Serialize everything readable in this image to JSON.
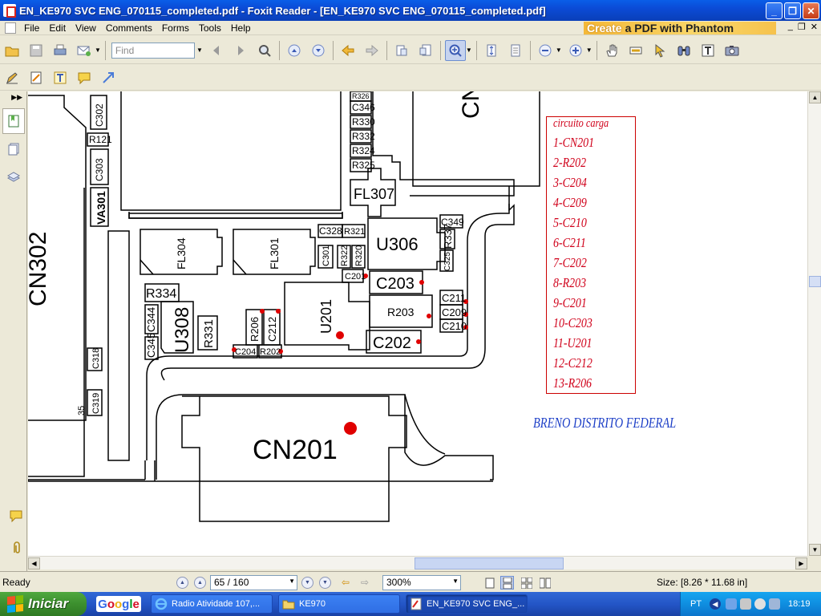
{
  "window": {
    "title": "EN_KE970 SVC ENG_070115_completed.pdf - Foxit Reader - [EN_KE970 SVC ENG_070115_completed.pdf]",
    "minimize": "_",
    "restore": "❐",
    "close": "✕"
  },
  "menubar": {
    "items": [
      "File",
      "Edit",
      "View",
      "Comments",
      "Forms",
      "Tools",
      "Help"
    ],
    "ad_prefix": "Create",
    "ad_middle": "a PDF with",
    "ad_suffix": "Phantom",
    "doc_minimize": "_",
    "doc_restore": "❐",
    "doc_close": "✕"
  },
  "toolbar": {
    "find_placeholder": "Find"
  },
  "schematic": {
    "labels": {
      "c302": "C302",
      "r121": "R121",
      "c303": "C303",
      "va301": "VA301",
      "cn302": "CN302",
      "c346": "C346",
      "r330": "R330",
      "r332": "R332",
      "r324": "R324",
      "r325": "R325",
      "r326": "R326",
      "cn_top": "CN",
      "fl307": "FL307",
      "fl304": "FL304",
      "fl301": "FL301",
      "c328": "C328",
      "r321": "R321",
      "c301": "C301",
      "r322": "R322",
      "r320": "R320",
      "u306": "U306",
      "c349": "C349",
      "r337": "R337",
      "c325": "C325",
      "c201": "C201",
      "c203": "C203",
      "r334": "R334",
      "c344": "C344",
      "u308": "U308",
      "r331": "R331",
      "c345": "C345",
      "r206": "R206",
      "c212": "C212",
      "c204": "C204",
      "r202": "R202",
      "u201": "U201",
      "r203": "R203",
      "c202": "C202",
      "c211": "C211",
      "c209": "C209",
      "c210": "C210",
      "c318": "C318",
      "c319": "C319",
      "n35": "35",
      "cn201": "CN201"
    }
  },
  "annotation": {
    "title": "circuito carga",
    "items": [
      "1-CN201",
      "2-R202",
      "3-C204",
      "4-C209",
      "5-C210",
      "6-C211",
      "7-C202",
      "8-R203",
      "9-C201",
      "10-C203",
      "11-U201",
      "12-C212",
      "13-R206"
    ],
    "color": "#d0001a",
    "signature": "BRENO DISTRITO FEDERAL",
    "signature_color": "#1d3fc7"
  },
  "statusbar": {
    "status": "Ready",
    "page": "65 / 160",
    "zoom": "300%",
    "size": "Size: [8.26 * 11.68 in]"
  },
  "taskbar": {
    "start": "Iniciar",
    "quicklaunch": "Google",
    "tasks": [
      "Radio Atividade 107,...",
      "KE970",
      "EN_KE970 SVC ENG_..."
    ],
    "language": "PT",
    "clock": "18:19",
    "accent": "#245edb"
  }
}
